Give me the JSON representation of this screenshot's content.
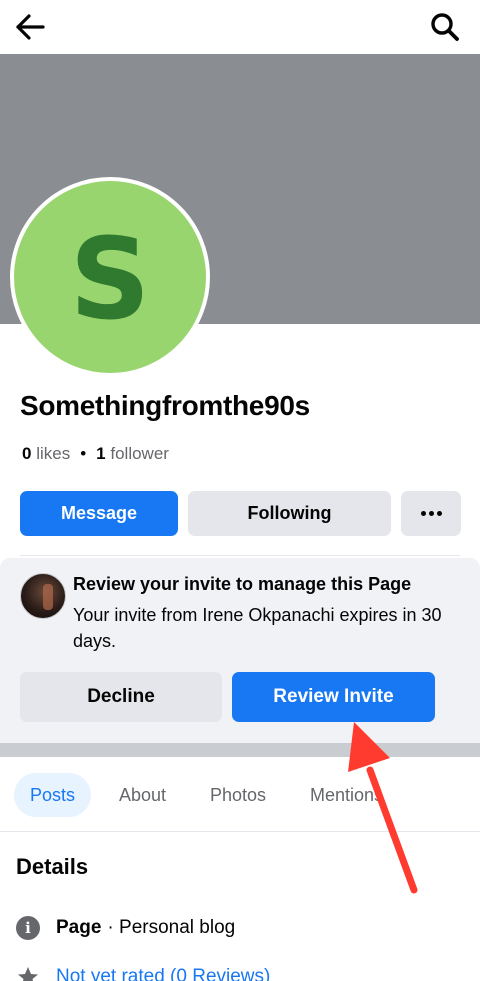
{
  "header": {
    "back_icon": "arrow-left-icon",
    "search_icon": "search-icon"
  },
  "profile": {
    "avatar_letter": "S",
    "name": "Somethingfromthe90s",
    "likes_count": "0",
    "likes_label": "likes",
    "separator": "•",
    "followers_count": "1",
    "followers_label": "follower"
  },
  "actions": {
    "message_label": "Message",
    "following_label": "Following",
    "more_icon": "more-dots-icon"
  },
  "invite": {
    "title": "Review your invite to manage this Page",
    "text": "Your invite from Irene Okpanachi expires in 30 days.",
    "decline_label": "Decline",
    "review_label": "Review Invite"
  },
  "tabs": {
    "items": [
      {
        "label": "Posts",
        "active": true
      },
      {
        "label": "About"
      },
      {
        "label": "Photos"
      },
      {
        "label": "Mentions"
      }
    ]
  },
  "details": {
    "title": "Details",
    "page_bold": "Page",
    "page_type": "· Personal blog",
    "rating_text": "Not yet rated (0 Reviews)"
  },
  "colors": {
    "brand_blue": "#1877f2",
    "avatar_bg": "#98d56e",
    "avatar_letter": "#2f7a2f",
    "cover_gray": "#8a8d91",
    "annotation_arrow": "#ff3b30"
  }
}
